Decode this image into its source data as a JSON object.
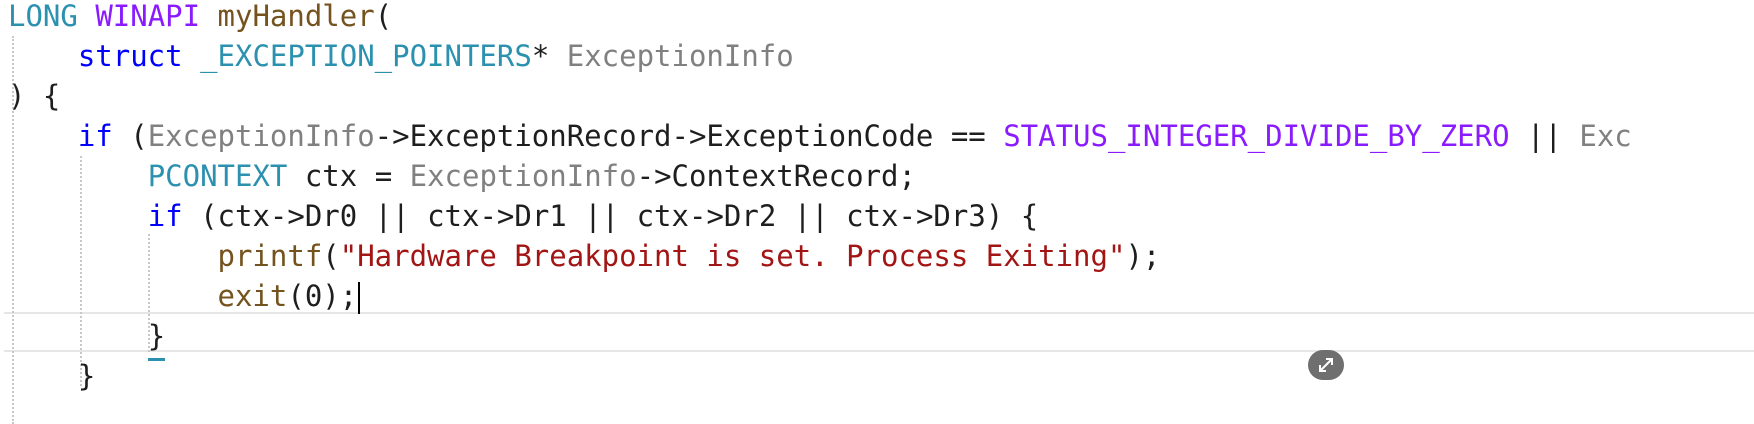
{
  "editor": {
    "lines": [
      [
        {
          "t": "LONG",
          "c": "type"
        },
        {
          "t": " ",
          "c": "text"
        },
        {
          "t": "WINAPI",
          "c": "macro"
        },
        {
          "t": " ",
          "c": "text"
        },
        {
          "t": "myHandler",
          "c": "func"
        },
        {
          "t": "(",
          "c": "text"
        }
      ],
      [
        {
          "t": "    ",
          "c": "text"
        },
        {
          "t": "struct",
          "c": "kw"
        },
        {
          "t": " ",
          "c": "text"
        },
        {
          "t": "_EXCEPTION_POINTERS",
          "c": "type"
        },
        {
          "t": "* ",
          "c": "text"
        },
        {
          "t": "ExceptionInfo",
          "c": "param"
        }
      ],
      [
        {
          "t": ") {",
          "c": "text"
        }
      ],
      [
        {
          "t": "    ",
          "c": "text"
        },
        {
          "t": "if",
          "c": "kw"
        },
        {
          "t": " (",
          "c": "text"
        },
        {
          "t": "ExceptionInfo",
          "c": "param"
        },
        {
          "t": "->ExceptionRecord->ExceptionCode == ",
          "c": "text"
        },
        {
          "t": "STATUS_INTEGER_DIVIDE_BY_ZERO",
          "c": "macro"
        },
        {
          "t": " || ",
          "c": "text"
        },
        {
          "t": "Exc",
          "c": "param"
        }
      ],
      [
        {
          "t": "        ",
          "c": "text"
        },
        {
          "t": "PCONTEXT",
          "c": "type"
        },
        {
          "t": " ",
          "c": "text"
        },
        {
          "t": "ctx",
          "c": "text"
        },
        {
          "t": " = ",
          "c": "text"
        },
        {
          "t": "ExceptionInfo",
          "c": "param"
        },
        {
          "t": "->ContextRecord;",
          "c": "text"
        }
      ],
      [
        {
          "t": "        ",
          "c": "text"
        },
        {
          "t": "if",
          "c": "kw"
        },
        {
          "t": " (",
          "c": "text"
        },
        {
          "t": "ctx",
          "c": "text"
        },
        {
          "t": "->Dr0 || ",
          "c": "text"
        },
        {
          "t": "ctx",
          "c": "text"
        },
        {
          "t": "->Dr1 || ",
          "c": "text"
        },
        {
          "t": "ctx",
          "c": "text"
        },
        {
          "t": "->Dr2 || ",
          "c": "text"
        },
        {
          "t": "ctx",
          "c": "text"
        },
        {
          "t": "->Dr3) {",
          "c": "text"
        }
      ],
      [
        {
          "t": "            ",
          "c": "text"
        },
        {
          "t": "printf",
          "c": "func"
        },
        {
          "t": "(",
          "c": "text"
        },
        {
          "t": "\"Hardware Breakpoint is set. Process Exiting\"",
          "c": "str"
        },
        {
          "t": ");",
          "c": "text"
        }
      ],
      [
        {
          "t": "            ",
          "c": "text"
        },
        {
          "t": "exit",
          "c": "func"
        },
        {
          "t": "(0);",
          "c": "text"
        }
      ],
      [
        {
          "t": "        ",
          "c": "text"
        },
        {
          "t": "}",
          "c": "text",
          "squiggle": true
        }
      ],
      [
        {
          "t": "    ",
          "c": "text"
        },
        {
          "t": "}",
          "c": "text"
        }
      ]
    ],
    "caret_line": 7
  },
  "colors": {
    "keyword": "#0000ff",
    "type": "#2b91af",
    "macro": "#8a1bff",
    "parameter": "#808080",
    "function": "#74531f",
    "string": "#a31515",
    "text": "#1e1e1e"
  },
  "icons": {
    "collapse_pill": "collapse-arrows-icon"
  }
}
